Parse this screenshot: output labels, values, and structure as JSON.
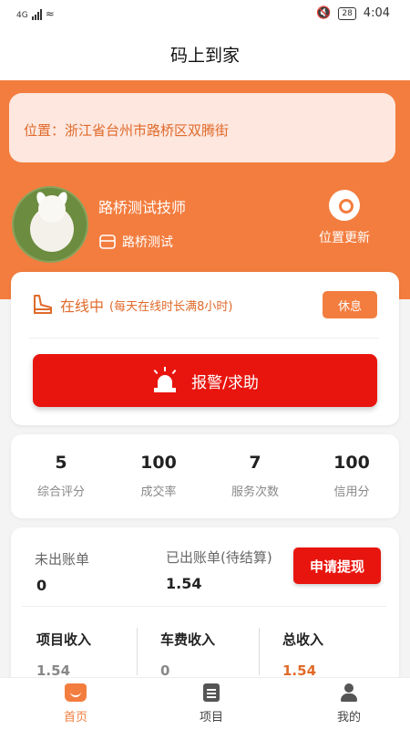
{
  "status_bar": {
    "network": "4G",
    "battery": "28",
    "time": "4:04"
  },
  "title": "码上到家",
  "location": {
    "text": "位置：浙江省台州市路桥区双腾街"
  },
  "profile": {
    "name": "路桥测试技师",
    "shop": "路桥测试"
  },
  "location_update_label": "位置更新",
  "online": {
    "status": "在线中",
    "note": "(每天在线时长满8小时)",
    "rest_label": "休息"
  },
  "alarm_label": "报警/求助",
  "stats": [
    {
      "value": "5",
      "label": "综合评分"
    },
    {
      "value": "100",
      "label": "成交率"
    },
    {
      "value": "7",
      "label": "服务次数"
    },
    {
      "value": "100",
      "label": "信用分"
    }
  ],
  "bill": {
    "unbilled_label": "未出账单",
    "unbilled_value": "0",
    "billed_label": "已出账单(待结算)",
    "billed_value": "1.54",
    "withdraw_label": "申请提现"
  },
  "income": [
    {
      "label": "项目收入",
      "value": "1.54"
    },
    {
      "label": "车费收入",
      "value": "0"
    },
    {
      "label": "总收入",
      "value": "1.54"
    }
  ],
  "tabs": [
    {
      "label": "首页",
      "icon": "home-icon",
      "active": true
    },
    {
      "label": "项目",
      "icon": "document-icon",
      "active": false
    },
    {
      "label": "我的",
      "icon": "user-icon",
      "active": false
    }
  ],
  "colors": {
    "brand": "#f37d3e",
    "alarm": "#e8150e",
    "total_income": "#e06a2a"
  }
}
